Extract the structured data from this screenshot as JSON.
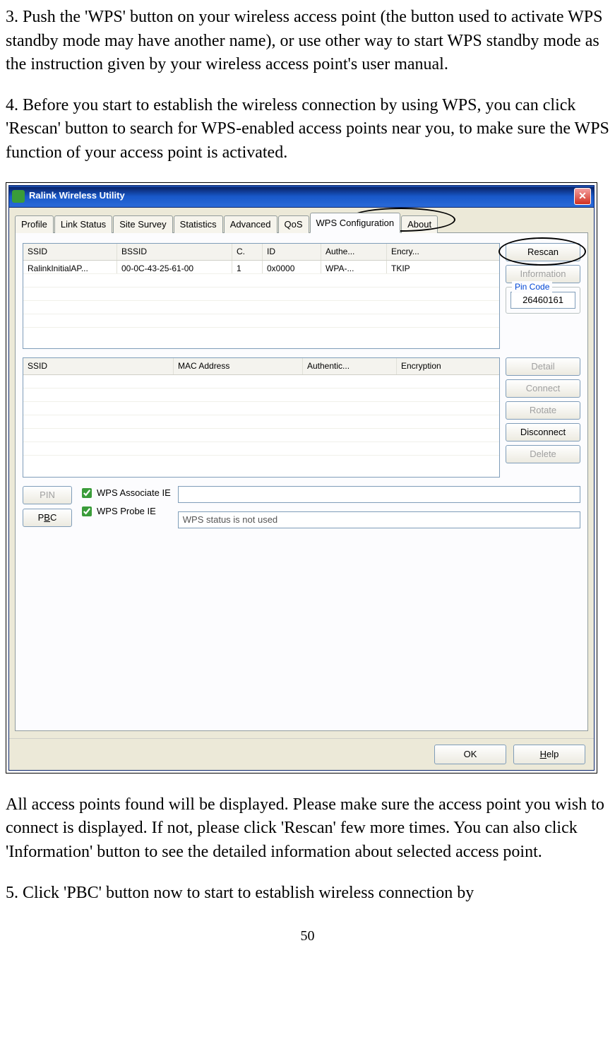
{
  "paragraphs": {
    "p3": "3. Push the 'WPS' button on your wireless access point (the button used to activate WPS standby mode may have another name), or use other way to start WPS standby mode as the instruction given by your wireless access point's user manual.",
    "p4": "4. Before you start to establish the wireless connection by using WPS, you can click 'Rescan' button to search for WPS-enabled access points near you, to make sure the WPS function of your access point is activated.",
    "pAfter": "All access points found will be displayed. Please make sure the access point you wish to connect is displayed. If not, please click 'Rescan' few more times. You can also click 'Information' button to see the detailed information about selected access point.",
    "p5": "5. Click 'PBC' button now to start to establish wireless connection by"
  },
  "page_number": "50",
  "window": {
    "title": "Ralink Wireless Utility",
    "tabs": [
      "Profile",
      "Link Status",
      "Site Survey",
      "Statistics",
      "Advanced",
      "QoS",
      "WPS Configuration",
      "About"
    ],
    "active_tab_index": 6,
    "top_list": {
      "headers": [
        "SSID",
        "BSSID",
        "C.",
        "ID",
        "Authe...",
        "Encry..."
      ],
      "row": [
        "RalinkInitialAP...",
        "00-0C-43-25-61-00",
        "1",
        "0x0000",
        "WPA-...",
        "TKIP"
      ]
    },
    "side_buttons_top": {
      "rescan": "Rescan",
      "information": "Information",
      "pin_label": "Pin Code",
      "pin_value": "26460161"
    },
    "bottom_list": {
      "headers": [
        "SSID",
        "MAC Address",
        "Authentic...",
        "Encryption"
      ]
    },
    "side_buttons_bottom": [
      "Detail",
      "Connect",
      "Rotate",
      "Disconnect",
      "Delete"
    ],
    "side_buttons_bottom_enabled": [
      false,
      false,
      false,
      true,
      false
    ],
    "pin_btn": "PIN",
    "pbc_btn": "PBC",
    "wps_assoc": "WPS Associate IE",
    "wps_probe": "WPS Probe IE",
    "status_text": "WPS status is not used",
    "ok": "OK",
    "help": "Help"
  }
}
